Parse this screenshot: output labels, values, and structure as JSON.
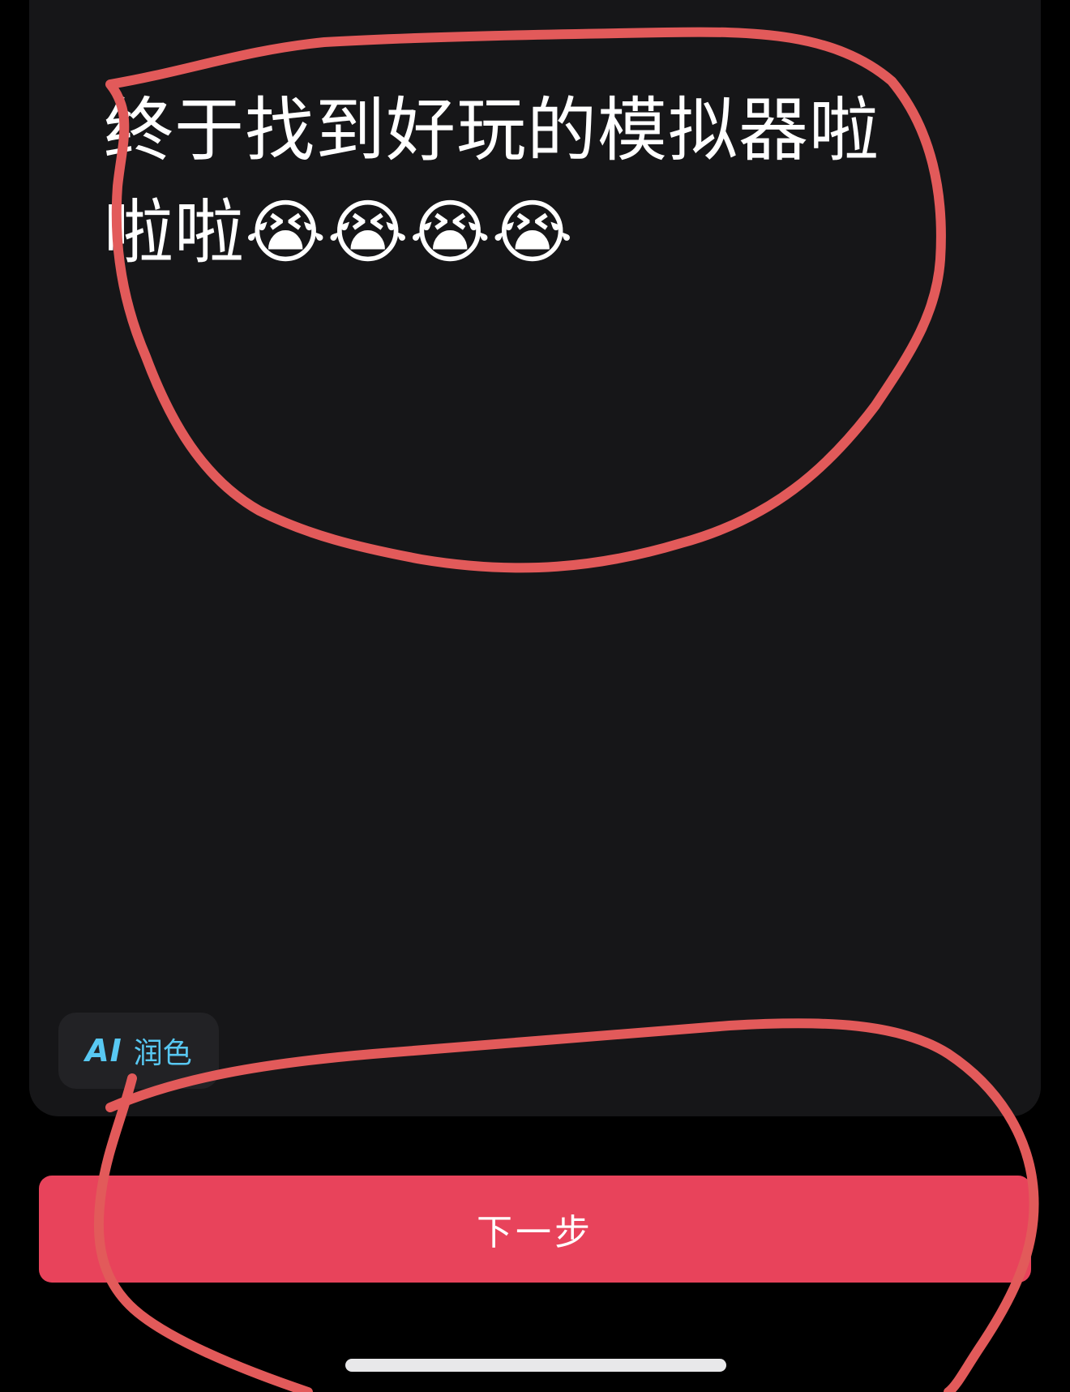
{
  "post": {
    "text": "终于找到好玩的模拟器啦啦啦😭😭😭😭"
  },
  "ai_polish": {
    "mark": "AI",
    "label": "润色"
  },
  "next_button": {
    "label": "下一步"
  },
  "colors": {
    "background": "#000000",
    "panel": "#161618",
    "accent": "#e8435b",
    "ai_text": "#58c8f2",
    "annotation": "#e25a5a"
  }
}
